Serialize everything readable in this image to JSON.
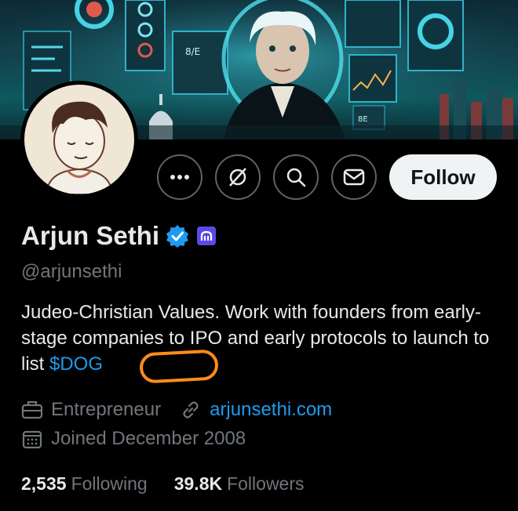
{
  "profile": {
    "name": "Arjun Sethi",
    "handle": "@arjunsethi",
    "bio_main": "Judeo-Christian Values. Work with founders from early-stage companies to IPO and early protocols to launch to list ",
    "bio_cashtag": "$DOG",
    "category": "Entrepreneur",
    "website": "arjunsethi.com",
    "joined": "Joined December 2008",
    "following_count": "2,535",
    "following_label": "Following",
    "followers_count": "39.8K",
    "followers_label": "Followers"
  },
  "actions": {
    "more_icon": "more-horizontal-icon",
    "subscribe_icon": "grok-slash-icon",
    "search_icon": "search-icon",
    "message_icon": "envelope-icon",
    "follow_label": "Follow"
  },
  "banner": {
    "panel_text_1": "8/E",
    "panel_text_2": "8E"
  },
  "colors": {
    "background": "#000000",
    "accent_blue": "#1d9bf0",
    "verified_blue": "#1d9bf0",
    "highlight_orange": "#ff8c1a",
    "affiliate_purple": "#5b4ae6"
  }
}
